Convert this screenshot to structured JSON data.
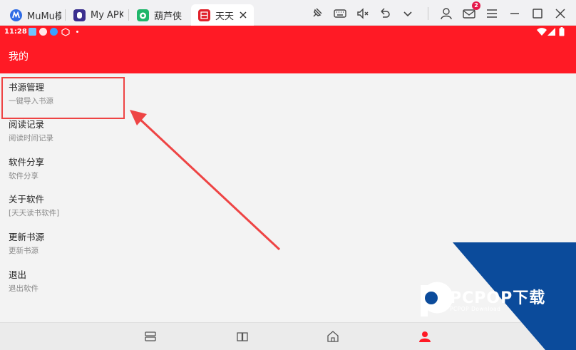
{
  "tabs": [
    {
      "label": "MuMu模",
      "icon": "mumu-logo-icon"
    },
    {
      "label": "My APK",
      "icon": "myapk-app-icon"
    },
    {
      "label": "葫芦侠",
      "icon": "huluxia-app-icon"
    },
    {
      "label": "天天",
      "icon": "tiantian-app-icon"
    }
  ],
  "toolbar": {
    "mail_badge": "2"
  },
  "statusbar": {
    "time": "11:28"
  },
  "appbar": {
    "title": "我的"
  },
  "menu": [
    {
      "title": "书源管理",
      "subtitle": "一键导入书源"
    },
    {
      "title": "阅读记录",
      "subtitle": "阅读时间记录"
    },
    {
      "title": "软件分享",
      "subtitle": "软件分享"
    },
    {
      "title": "关于软件",
      "subtitle": "[天天读书软件]"
    },
    {
      "title": "更新书源",
      "subtitle": "更新书源"
    },
    {
      "title": "退出",
      "subtitle": "退出软件"
    }
  ],
  "bottom_nav": [
    "list-icon",
    "book-icon",
    "home-icon",
    "user-icon"
  ],
  "watermark": {
    "brand": "PCPOP下载",
    "sub": "PCPOP Download"
  },
  "colors": {
    "accent": "#ff1a25",
    "highlight": "#ee4444",
    "watermark": "#0b4b9b"
  }
}
